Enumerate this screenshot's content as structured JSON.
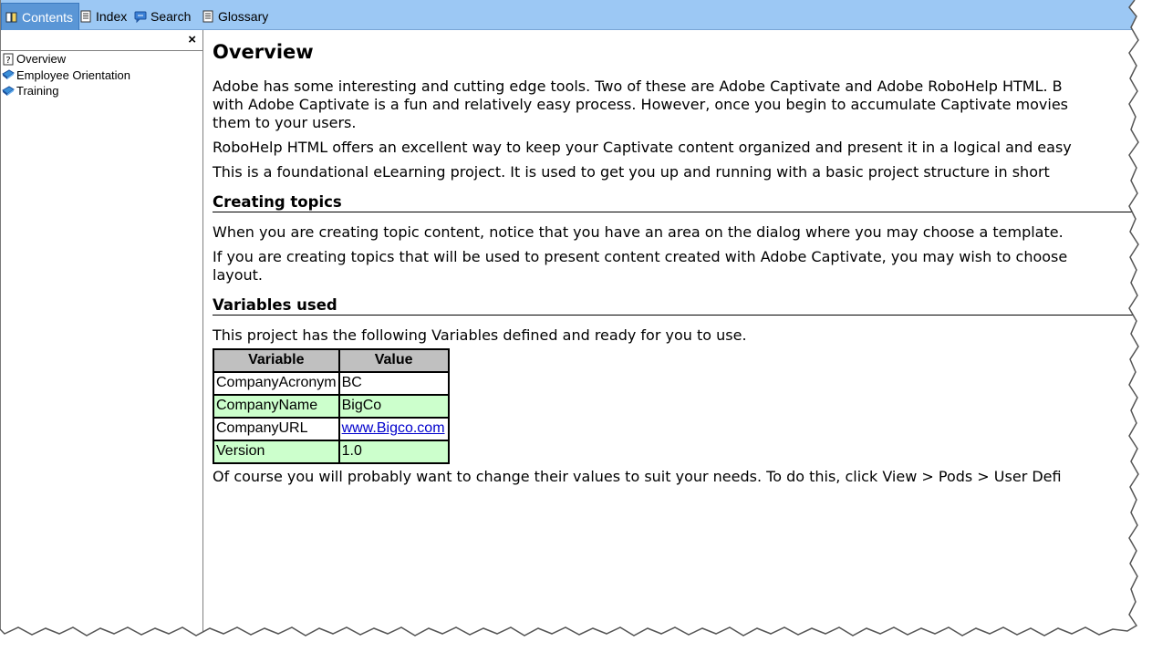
{
  "tabs": [
    {
      "label": "Contents",
      "icon": "book-icon",
      "active": true
    },
    {
      "label": "Index",
      "icon": "index-page-icon",
      "active": false
    },
    {
      "label": "Search",
      "icon": "search-bubble-icon",
      "active": false
    },
    {
      "label": "Glossary",
      "icon": "glossary-page-icon",
      "active": false
    }
  ],
  "sidebar": {
    "close_label": "×",
    "items": [
      {
        "label": "Overview",
        "icon": "topic-question-icon"
      },
      {
        "label": "Employee Orientation",
        "icon": "closed-book-icon"
      },
      {
        "label": "Training",
        "icon": "closed-book-icon"
      }
    ]
  },
  "topic": {
    "title": "Overview",
    "intro_line1": "Adobe has some interesting and cutting edge tools. Two of these are Adobe Captivate and Adobe RoboHelp HTML. B",
    "intro_line2": "with Adobe Captivate is a fun and relatively easy process. However, once you begin to accumulate Captivate movies",
    "intro_line3": "them to your users.",
    "para2": "RoboHelp HTML offers an excellent way to keep your Captivate content organized and present it in a logical and easy",
    "para3": "This is a foundational eLearning project. It is used to get you up and running with a basic project structure in short",
    "section1_title": "Creating topics",
    "section1_para1": "When you are creating topic content, notice that you have an area on the dialog where you may choose a template.",
    "section1_para2_line1": "If you are creating topics that will be used to present content created with Adobe Captivate, you may wish to choose",
    "section1_para2_line2": "layout.",
    "section2_title": "Variables used",
    "section2_intro": "This project has the following Variables defined and ready for you to use.",
    "table": {
      "headers": [
        "Variable",
        "Value"
      ],
      "rows": [
        [
          "CompanyAcronym",
          "BC"
        ],
        [
          "CompanyName",
          "BigCo"
        ],
        [
          "CompanyURL",
          "www.Bigco.com"
        ],
        [
          "Version",
          "1.0"
        ]
      ]
    },
    "closing": "Of course you will probably want to change their values to suit your needs. To do this, click View > Pods > User Defi"
  },
  "colors": {
    "tabbar": "#9cc8f4",
    "active_tab": "#5a96d6",
    "table_header": "#c0c0c0",
    "table_alt_row": "#ccffcc",
    "link": "#0000cc"
  }
}
